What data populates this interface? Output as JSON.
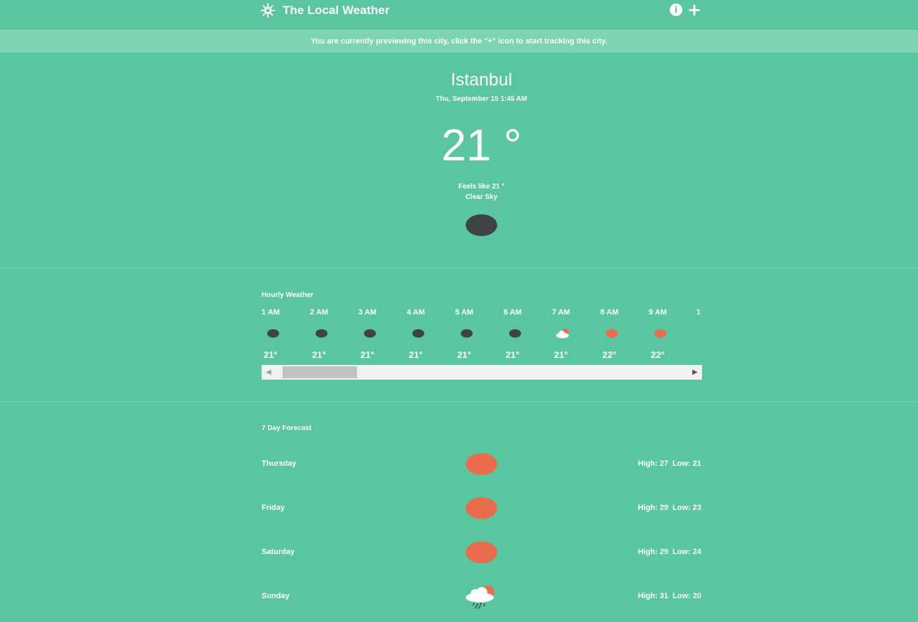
{
  "header": {
    "title": "The Local Weather",
    "brand_icon": "sun-gear-icon",
    "actions": [
      {
        "name": "info",
        "icon": "info-icon",
        "glyph": "i"
      },
      {
        "name": "add",
        "icon": "plus-icon",
        "glyph": "+"
      }
    ]
  },
  "banner": {
    "text": "You are currently previewing this city, click the \"+\" icon to start tracking this city."
  },
  "current": {
    "city": "Istanbul",
    "datetime": "Thu, September 15 1:45 AM",
    "temperature": "21 °",
    "feels_like": "Feels like 21 °",
    "condition": "Clear Sky",
    "icon": "moon-icon"
  },
  "hourly": {
    "title": "Hourly Weather",
    "items": [
      {
        "time": "1 AM",
        "temp": "21°",
        "icon": "moon-icon"
      },
      {
        "time": "2 AM",
        "temp": "21°",
        "icon": "moon-icon"
      },
      {
        "time": "3 AM",
        "temp": "21°",
        "icon": "moon-icon"
      },
      {
        "time": "4 AM",
        "temp": "21°",
        "icon": "moon-icon"
      },
      {
        "time": "5 AM",
        "temp": "21°",
        "icon": "moon-icon"
      },
      {
        "time": "6 AM",
        "temp": "21°",
        "icon": "moon-icon"
      },
      {
        "time": "7 AM",
        "temp": "21°",
        "icon": "partly-cloudy-icon"
      },
      {
        "time": "8 AM",
        "temp": "22°",
        "icon": "sun-icon"
      },
      {
        "time": "9 AM",
        "temp": "22°",
        "icon": "sun-icon"
      },
      {
        "time": "1",
        "temp": "",
        "icon": ""
      }
    ]
  },
  "forecast": {
    "title": "7 Day Forecast",
    "days": [
      {
        "day": "Thursday",
        "high": "High: 27",
        "low": "Low: 21",
        "icon": "sun-icon"
      },
      {
        "day": "Friday",
        "high": "High: 29",
        "low": "Low: 23",
        "icon": "sun-icon"
      },
      {
        "day": "Saturday",
        "high": "High: 29",
        "low": "Low: 24",
        "icon": "sun-icon"
      },
      {
        "day": "Sunday",
        "high": "High: 31",
        "low": "Low: 20",
        "icon": "rain-cloud-icon"
      }
    ]
  },
  "colors": {
    "background": "#5ac69f",
    "banner": "#7dd4b3",
    "moon": "#404346",
    "sun": "#ea6c4f"
  }
}
